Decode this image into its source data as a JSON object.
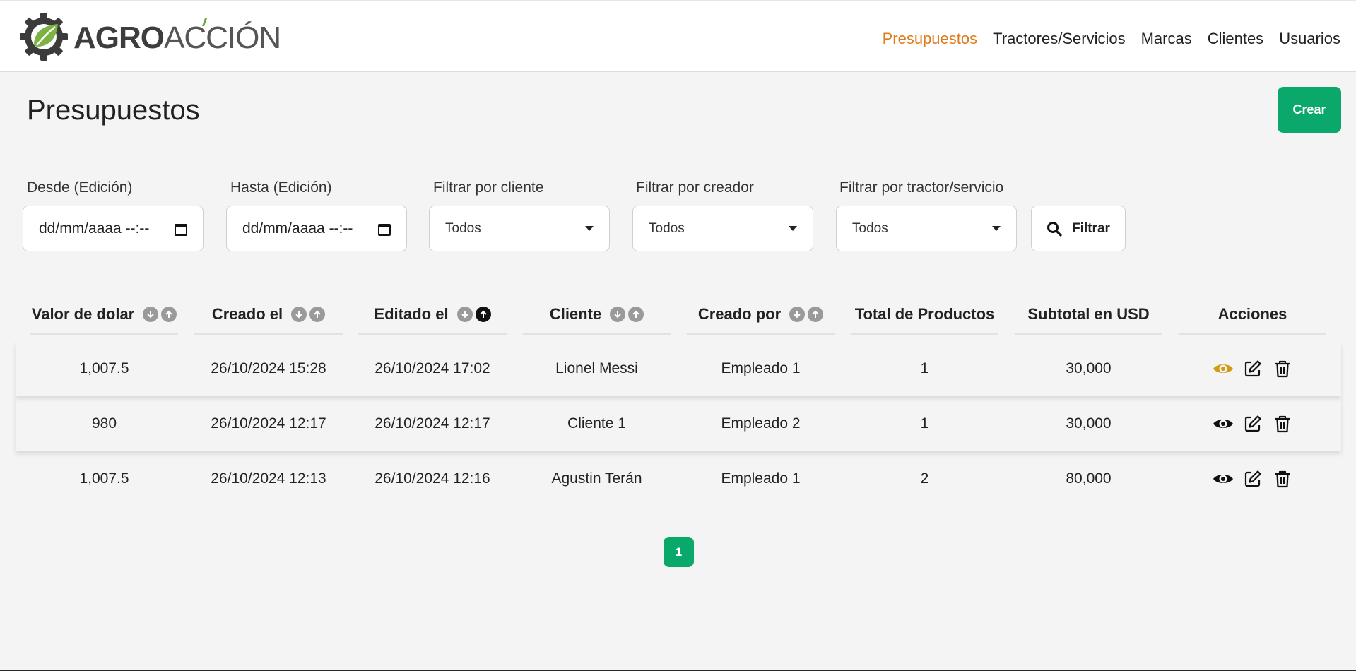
{
  "brand": {
    "logo_text_bold": "AGRO",
    "logo_text_light": "ACCIÓN"
  },
  "nav": {
    "items": [
      {
        "label": "Presupuestos",
        "active": true
      },
      {
        "label": "Tractores/Servicios",
        "active": false
      },
      {
        "label": "Marcas",
        "active": false
      },
      {
        "label": "Clientes",
        "active": false
      },
      {
        "label": "Usuarios",
        "active": false
      }
    ]
  },
  "page": {
    "title": "Presupuestos",
    "create_label": "Crear"
  },
  "filters": {
    "desde_label": "Desde (Edición)",
    "desde_value": "dd/mm/aaaa --:--",
    "hasta_label": "Hasta (Edición)",
    "hasta_value": "dd/mm/aaaa --:--",
    "cliente_label": "Filtrar por cliente",
    "cliente_value": "Todos",
    "creador_label": "Filtrar por creador",
    "creador_value": "Todos",
    "tractor_label": "Filtrar por tractor/servicio",
    "tractor_value": "Todos",
    "filter_button": "Filtrar"
  },
  "table": {
    "headers": [
      "Valor de dolar",
      "Creado el",
      "Editado el",
      "Cliente",
      "Creado por",
      "Total de Productos",
      "Subtotal en USD",
      "Acciones"
    ],
    "rows": [
      [
        "1,007.5",
        "26/10/2024 15:28",
        "26/10/2024 17:02",
        "Lionel Messi",
        "Empleado 1",
        "1",
        "30,000"
      ],
      [
        "980",
        "26/10/2024 12:17",
        "26/10/2024 12:17",
        "Cliente 1",
        "Empleado 2",
        "1",
        "30,000"
      ],
      [
        "1,007.5",
        "26/10/2024 12:13",
        "26/10/2024 12:16",
        "Agustin Terán",
        "Empleado 1",
        "2",
        "80,000"
      ]
    ]
  },
  "pagination": {
    "current": "1"
  },
  "colors": {
    "accent": "#0aa86a",
    "nav_active": "#e07b1a",
    "eye_highlight": "#d39b12"
  },
  "icons": [
    "gear-leaf-logo",
    "calendar-icon",
    "chevron-down-icon",
    "search-icon",
    "sort-down-icon",
    "sort-up-icon",
    "eye-icon",
    "edit-icon",
    "trash-icon"
  ]
}
